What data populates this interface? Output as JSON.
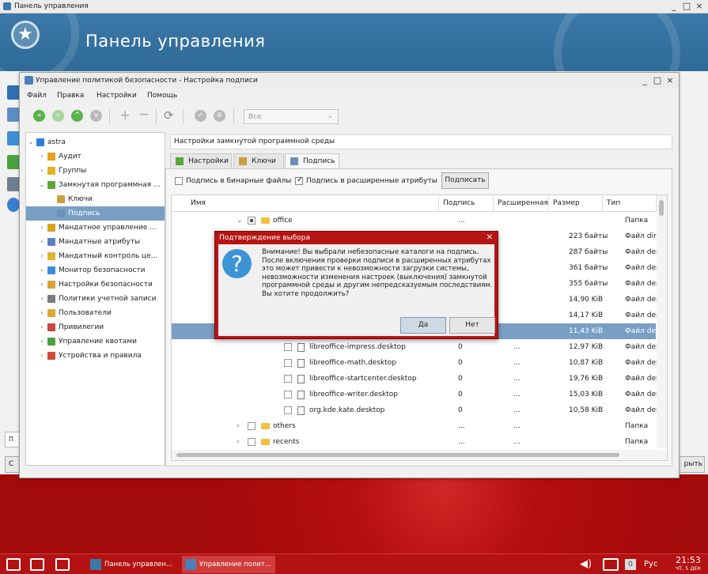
{
  "outer_window": {
    "title": "Панель управления",
    "banner_title": "Панель управления",
    "left_field_partial": "П",
    "left_button_partial": "С",
    "right_button_partial": "рыть"
  },
  "inner_window": {
    "title": "Управление политикой безопасности - Настройка подписи",
    "menu": [
      "Файл",
      "Правка",
      "Настройки",
      "Помощь"
    ],
    "combo_value": "Все"
  },
  "tree": [
    {
      "label": "astra",
      "level": 0,
      "expanded": true,
      "icon": "computer-icon",
      "color": "#2f7fd0"
    },
    {
      "label": "Аудит",
      "level": 1,
      "icon": "audit-icon",
      "color": "#e6a21a"
    },
    {
      "label": "Группы",
      "level": 1,
      "icon": "groups-icon",
      "color": "#e3b020"
    },
    {
      "label": "Замкнутая программная ...",
      "level": 1,
      "expanded": true,
      "icon": "closed-env-icon",
      "color": "#58a83a"
    },
    {
      "label": "Ключи",
      "level": 2,
      "icon": "keys-icon",
      "color": "#c9a043"
    },
    {
      "label": "Подпись",
      "level": 2,
      "selected": true,
      "icon": "signature-icon",
      "color": "#6c8fb8"
    },
    {
      "label": "Мандатное управление ...",
      "level": 1,
      "icon": "mandatory-control-icon",
      "color": "#d9a521"
    },
    {
      "label": "Мандатные атрибуты",
      "level": 1,
      "icon": "mandatory-attrs-icon",
      "color": "#5d7fc0"
    },
    {
      "label": "Мандатный контроль це...",
      "level": 1,
      "icon": "integrity-icon",
      "color": "#e0b530"
    },
    {
      "label": "Монитор безопасности",
      "level": 1,
      "icon": "monitor-icon",
      "color": "#3b8fd8"
    },
    {
      "label": "Настройки безопасности",
      "level": 1,
      "icon": "security-settings-icon",
      "color": "#d7a33a"
    },
    {
      "label": "Политики учетной записи",
      "level": 1,
      "icon": "account-policy-icon",
      "color": "#7b7b7b"
    },
    {
      "label": "Пользователи",
      "level": 1,
      "icon": "users-icon",
      "color": "#e0a830"
    },
    {
      "label": "Привилегии",
      "level": 1,
      "icon": "privileges-icon",
      "color": "#c74a3a"
    },
    {
      "label": "Управление квотами",
      "level": 1,
      "icon": "quotas-icon",
      "color": "#4aa03c"
    },
    {
      "label": "Устройства и правила",
      "level": 1,
      "icon": "devices-icon",
      "color": "#d04a3a"
    }
  ],
  "right": {
    "section_title": "Настройки замкнутой программной среды",
    "tabs": [
      "Настройки",
      "Ключи",
      "Подпись"
    ],
    "chk_binary": "Подпись в бинарные файлы",
    "chk_xattr": "Подпись в расширенные атрибуты",
    "sign_button": "Подписать"
  },
  "table": {
    "columns": [
      "Имя",
      "Подпись",
      "Расширенная",
      "Размер",
      "Тип"
    ],
    "rows": [
      {
        "name": "office",
        "sig": "...",
        "ext": "",
        "size": "",
        "type": "Папка",
        "kind": "folder",
        "indent": 2,
        "expanded": true,
        "checkbox": "partial"
      },
      {
        "name": "",
        "sig": "",
        "ext": "",
        "size": "223 байты",
        "type": "Файл direct...",
        "kind": "hidden"
      },
      {
        "name": "",
        "sig": "",
        "ext": "",
        "size": "287 байты",
        "type": "Файл desktop",
        "kind": "hidden"
      },
      {
        "name": "",
        "sig": "",
        "ext": "",
        "size": "361 байты",
        "type": "Файл desktop",
        "kind": "hidden"
      },
      {
        "name": "",
        "sig": "",
        "ext": "",
        "size": "355 байты",
        "type": "Файл desktop",
        "kind": "hidden"
      },
      {
        "name": "",
        "sig": "",
        "ext": "",
        "size": "14,90 KiB",
        "type": "Файл desktop",
        "kind": "hidden"
      },
      {
        "name": "",
        "sig": "",
        "ext": "",
        "size": "14,17 KiB",
        "type": "Файл desktop",
        "kind": "hidden"
      },
      {
        "name": "",
        "sig": "",
        "ext": "",
        "size": "11,43 KiB",
        "type": "Файл desktop",
        "kind": "hidden",
        "selected": true
      },
      {
        "name": "libreoffice-impress.desktop",
        "sig": "0",
        "ext": "...",
        "size": "12,97 KiB",
        "type": "Файл desktop",
        "kind": "file",
        "indent": 3
      },
      {
        "name": "libreoffice-math.desktop",
        "sig": "0",
        "ext": "...",
        "size": "10,87 KiB",
        "type": "Файл desktop",
        "kind": "file",
        "indent": 3
      },
      {
        "name": "libreoffice-startcenter.desktop",
        "sig": "0",
        "ext": "...",
        "size": "19,76 KiB",
        "type": "Файл desktop",
        "kind": "file",
        "indent": 3
      },
      {
        "name": "libreoffice-writer.desktop",
        "sig": "0",
        "ext": "...",
        "size": "15,03 KiB",
        "type": "Файл desktop",
        "kind": "file",
        "indent": 3
      },
      {
        "name": "org.kde.kate.desktop",
        "sig": "0",
        "ext": "...",
        "size": "10,58 KiB",
        "type": "Файл desktop",
        "kind": "file",
        "indent": 3
      },
      {
        "name": "others",
        "sig": "...",
        "ext": "...",
        "size": "",
        "type": "Папка",
        "kind": "folder",
        "indent": 2
      },
      {
        "name": "recents",
        "sig": "...",
        "ext": "...",
        "size": "",
        "type": "Папка",
        "kind": "folder",
        "indent": 2
      }
    ]
  },
  "dialog": {
    "title": "Подтверждение выбора",
    "message": "Внимание! Вы выбрали небезопасные каталоги на подпись.\nПосле включения проверки подписи в расширенных атрибутах это может привести к невозможности загрузки системы, невозможности изменения настроек (выключения) замкнутой программной среды и другим непредсказуемым последствиям.\nВы хотите продолжить?",
    "yes": "Да",
    "no": "Нет"
  },
  "taskbar": {
    "tasks": [
      "Панель управлен...",
      "Управление полит..."
    ],
    "lang": "Рус",
    "counter": "0",
    "time": "21:53",
    "date": "ЧТ, 5 ДЕК"
  },
  "colors": {
    "accent": "#7a9fc4",
    "dialog_frame": "#b71414",
    "desktop": "#b80e0e",
    "banner": "#3c79a8"
  }
}
